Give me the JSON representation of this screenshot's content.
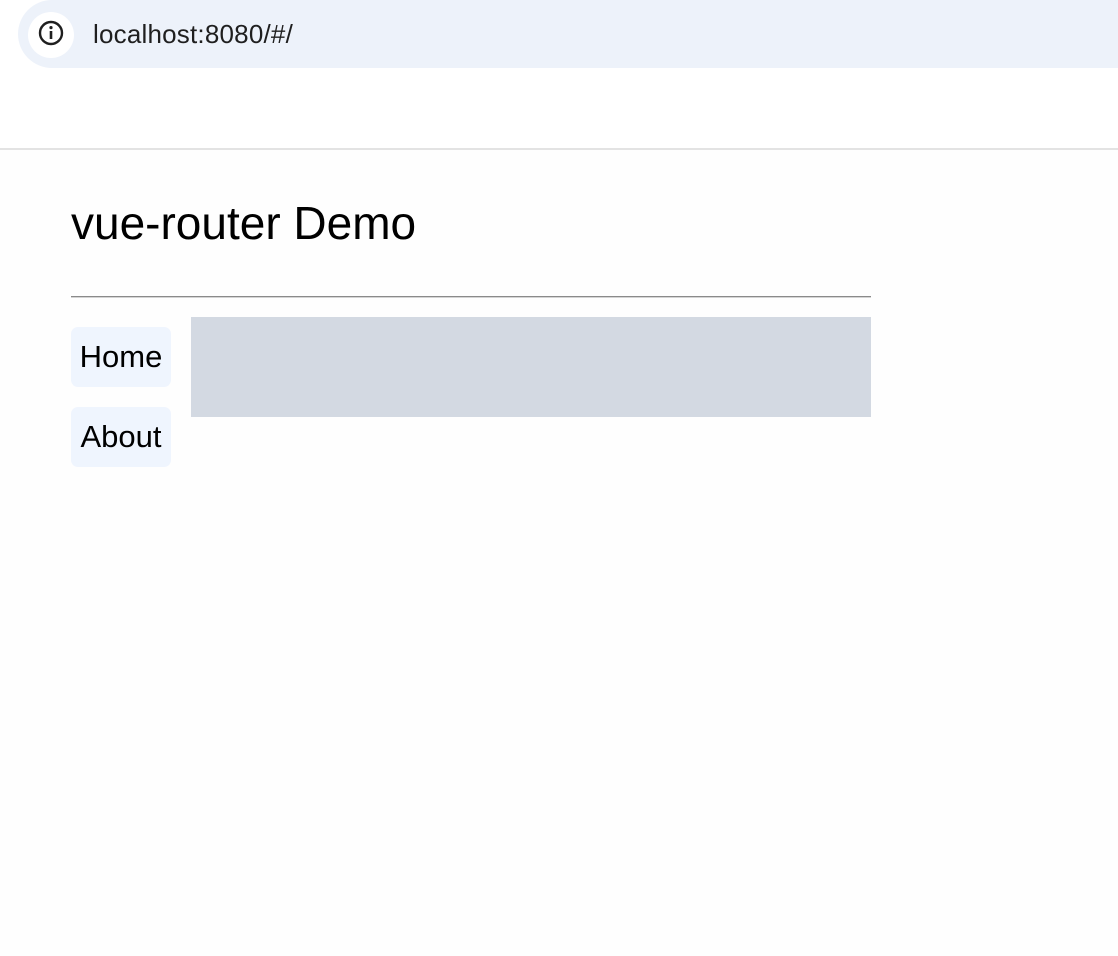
{
  "browser": {
    "url": "localhost:8080/#/",
    "site_info_icon": "info-circle-icon"
  },
  "app": {
    "title": "vue-router Demo",
    "nav": [
      {
        "label": "Home"
      },
      {
        "label": "About"
      }
    ]
  },
  "colors": {
    "address_bar_bg": "#edf2fa",
    "nav_link_bg": "#eff5fe",
    "router_view_bg": "#d3d9e2"
  }
}
